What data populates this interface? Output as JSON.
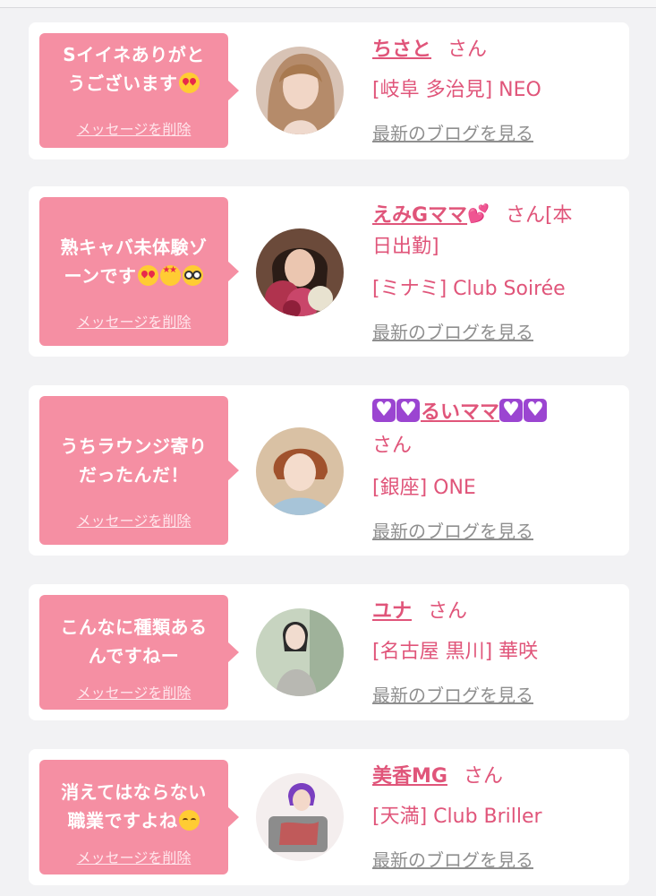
{
  "colors": {
    "bubble": "#f58fa3",
    "accent_text": "#e0557a",
    "muted_link": "#8f8f8f",
    "card_bg": "#ffffff",
    "page_bg": "#f2f2f4",
    "purple_heart": "#9b45d1"
  },
  "cards": [
    {
      "message_lines": [
        "Sイイネありがと",
        "うございます"
      ],
      "message_emojis": [
        "smiling-face-with-heart-eyes"
      ],
      "delete_label": "メッセージを削除",
      "name": "ちさと",
      "san": "さん",
      "location": "[岐阜 多治見] NEO",
      "blog_label": "最新のブログを見る"
    },
    {
      "message_lines": [
        "熟キャバ未体験ゾ",
        "ーンです"
      ],
      "message_emojis": [
        "smiling-face-with-heart-eyes",
        "star-struck",
        "nerd-face"
      ],
      "delete_label": "メッセージを削除",
      "name": "えみGママ",
      "name_suffix_emoji": "two-hearts",
      "san": "さん[本",
      "san_line2": "日出勤]",
      "location": "[ミナミ] Club Soirée",
      "blog_label": "最新のブログを見る"
    },
    {
      "message_lines": [
        "うちラウンジ寄り",
        "だったんだ！"
      ],
      "delete_label": "メッセージを削除",
      "name": "るいママ",
      "name_emojis": [
        "purple-heart",
        "purple-heart",
        "purple-heart",
        "purple-heart"
      ],
      "san": "さん",
      "location": "[銀座] ONE",
      "blog_label": "最新のブログを見る"
    },
    {
      "message_lines": [
        "こんなに種類ある",
        "んですねー"
      ],
      "delete_label": "メッセージを削除",
      "name": "ユナ",
      "san": "さん",
      "location": "[名古屋 黒川] 華咲",
      "blog_label": "最新のブログを見る"
    },
    {
      "message_lines": [
        "消えてはならない",
        "職業ですよね"
      ],
      "message_emojis": [
        "relieved-face"
      ],
      "delete_label": "メッセージを削除",
      "name": "美香MG",
      "san": "さん",
      "location": "[天満] Club Briller",
      "blog_label": "最新のブログを見る"
    }
  ]
}
